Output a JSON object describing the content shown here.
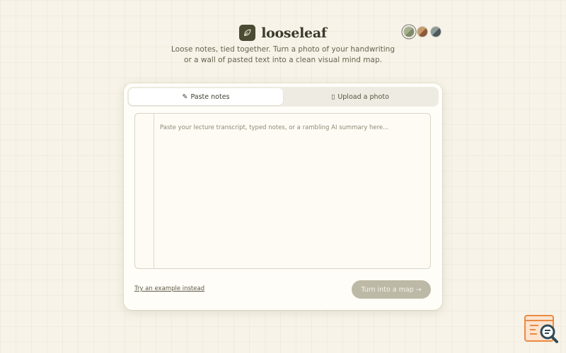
{
  "brand": {
    "name": "looseleaf",
    "logo_icon": "leaf-icon"
  },
  "tagline": {
    "line1": "Loose notes, tied together. Turn a photo of your handwriting",
    "line2": "or a wall of pasted text into a clean visual mind map."
  },
  "themes": [
    {
      "name": "sage",
      "colors": [
        "#7d8a68",
        "#a7b08f"
      ],
      "active": true
    },
    {
      "name": "terracotta",
      "colors": [
        "#8a5a3a",
        "#c79a6c"
      ],
      "active": false
    },
    {
      "name": "slate",
      "colors": [
        "#4c5a5c",
        "#8d9b98"
      ],
      "active": false
    }
  ],
  "tabs": [
    {
      "glyph": "✎",
      "icon": "pencil-icon",
      "label": "Paste notes",
      "active": true
    },
    {
      "glyph": "▯",
      "icon": "photo-icon",
      "label": "Upload a photo",
      "active": false
    }
  ],
  "editor": {
    "placeholder": "Paste your lecture transcript, typed notes, or a rambling AI summary here..."
  },
  "actions": {
    "example_link": "Try an example instead",
    "submit_label": "Turn into a map →"
  },
  "colors": {
    "background": "#f7f3e8",
    "card": "#fffdf8",
    "brand_dark": "#4b4a33",
    "submit_disabled": "#bcb9a6"
  }
}
